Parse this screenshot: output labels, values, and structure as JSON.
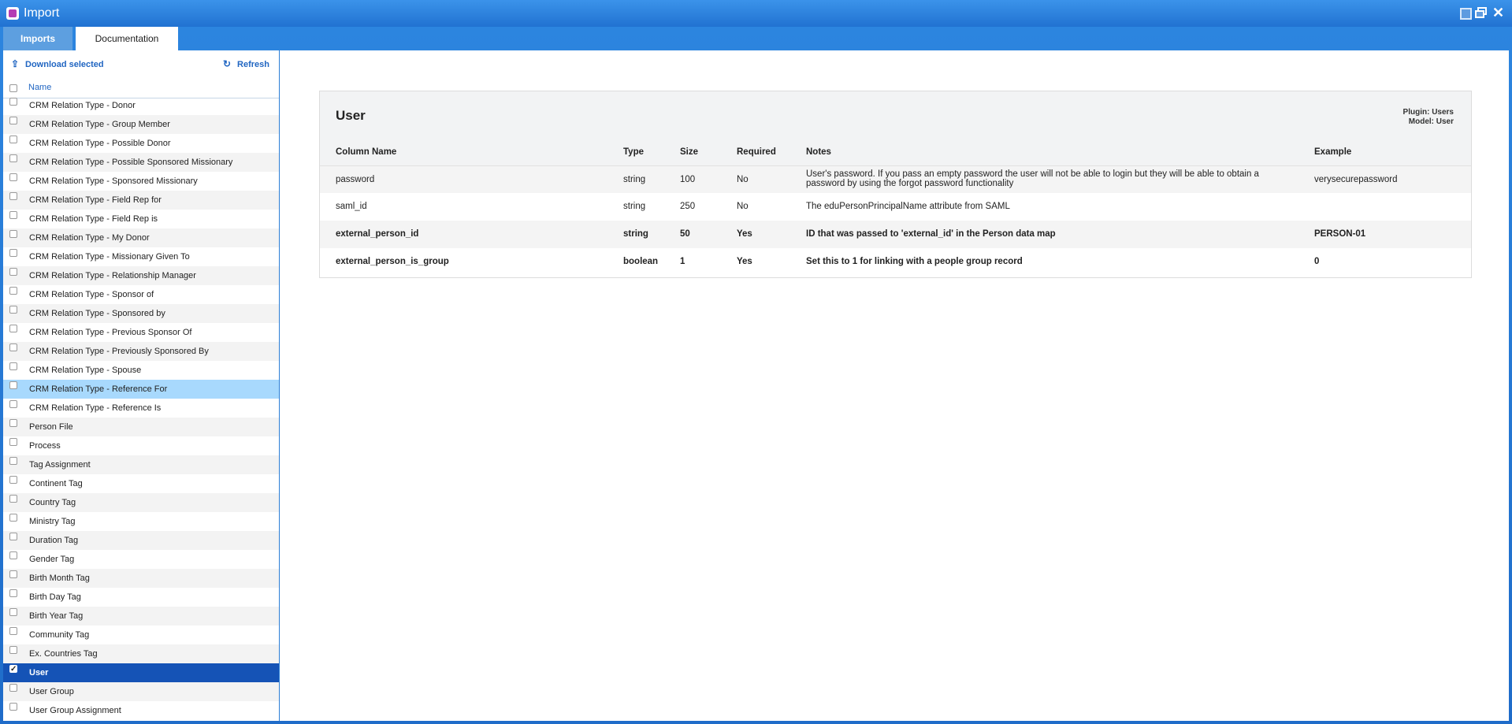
{
  "window": {
    "title": "Import",
    "controls": [
      "minimize-icon",
      "restore-icon",
      "close-icon"
    ]
  },
  "tabs": [
    {
      "label": "Imports",
      "active": false
    },
    {
      "label": "Documentation",
      "active": true
    }
  ],
  "toolbar": {
    "download_label": "Download selected",
    "refresh_label": "Refresh"
  },
  "list": {
    "header": "Name",
    "items": [
      {
        "label": "CRM Relation Type - Donor",
        "checked": false,
        "state": ""
      },
      {
        "label": "CRM Relation Type - Group Member",
        "checked": false,
        "state": ""
      },
      {
        "label": "CRM Relation Type - Possible Donor",
        "checked": false,
        "state": ""
      },
      {
        "label": "CRM Relation Type - Possible Sponsored Missionary",
        "checked": false,
        "state": ""
      },
      {
        "label": "CRM Relation Type - Sponsored Missionary",
        "checked": false,
        "state": ""
      },
      {
        "label": "CRM Relation Type - Field Rep for",
        "checked": false,
        "state": ""
      },
      {
        "label": "CRM Relation Type - Field Rep is",
        "checked": false,
        "state": ""
      },
      {
        "label": "CRM Relation Type - My Donor",
        "checked": false,
        "state": ""
      },
      {
        "label": "CRM Relation Type - Missionary Given To",
        "checked": false,
        "state": ""
      },
      {
        "label": "CRM Relation Type - Relationship Manager",
        "checked": false,
        "state": ""
      },
      {
        "label": "CRM Relation Type - Sponsor of",
        "checked": false,
        "state": ""
      },
      {
        "label": "CRM Relation Type - Sponsored by",
        "checked": false,
        "state": ""
      },
      {
        "label": "CRM Relation Type - Previous Sponsor Of",
        "checked": false,
        "state": ""
      },
      {
        "label": "CRM Relation Type - Previously Sponsored By",
        "checked": false,
        "state": ""
      },
      {
        "label": "CRM Relation Type - Spouse",
        "checked": false,
        "state": ""
      },
      {
        "label": "CRM Relation Type - Reference For",
        "checked": false,
        "state": "hover"
      },
      {
        "label": "CRM Relation Type - Reference Is",
        "checked": false,
        "state": ""
      },
      {
        "label": "Person File",
        "checked": false,
        "state": ""
      },
      {
        "label": "Process",
        "checked": false,
        "state": ""
      },
      {
        "label": "Tag Assignment",
        "checked": false,
        "state": ""
      },
      {
        "label": "Continent Tag",
        "checked": false,
        "state": ""
      },
      {
        "label": "Country Tag",
        "checked": false,
        "state": ""
      },
      {
        "label": "Ministry Tag",
        "checked": false,
        "state": ""
      },
      {
        "label": "Duration Tag",
        "checked": false,
        "state": ""
      },
      {
        "label": "Gender Tag",
        "checked": false,
        "state": ""
      },
      {
        "label": "Birth Month Tag",
        "checked": false,
        "state": ""
      },
      {
        "label": "Birth Day Tag",
        "checked": false,
        "state": ""
      },
      {
        "label": "Birth Year Tag",
        "checked": false,
        "state": ""
      },
      {
        "label": "Community Tag",
        "checked": false,
        "state": ""
      },
      {
        "label": "Ex. Countries Tag",
        "checked": false,
        "state": ""
      },
      {
        "label": "User",
        "checked": true,
        "state": "selected"
      },
      {
        "label": "User Group",
        "checked": false,
        "state": ""
      },
      {
        "label": "User Group Assignment",
        "checked": false,
        "state": ""
      }
    ]
  },
  "doc": {
    "title": "User",
    "plugin": "Plugin: Users",
    "model": "Model: User",
    "columns": [
      "Column Name",
      "Type",
      "Size",
      "Required",
      "Notes",
      "Example"
    ],
    "rows": [
      {
        "name": "password",
        "type": "string",
        "size": "100",
        "required": "No",
        "notes": "User's password. If you pass an empty password the user will not be able to login but they will be able to obtain a password by using the forgot password functionality",
        "example": "verysecurepassword",
        "bold": false
      },
      {
        "name": "saml_id",
        "type": "string",
        "size": "250",
        "required": "No",
        "notes": "The eduPersonPrincipalName attribute from SAML",
        "example": "",
        "bold": false
      },
      {
        "name": "external_person_id",
        "type": "string",
        "size": "50",
        "required": "Yes",
        "notes": "ID that was passed to 'external_id' in the Person data map",
        "example": "PERSON-01",
        "bold": true
      },
      {
        "name": "external_person_is_group",
        "type": "boolean",
        "size": "1",
        "required": "Yes",
        "notes": "Set this to 1 for linking with a people group record",
        "example": "0",
        "bold": true
      }
    ]
  },
  "colors": {
    "titlebar": "#2172d1",
    "accent": "#2166c2",
    "selected_row": "#1553b6",
    "hover_row": "#a8d9fd"
  }
}
